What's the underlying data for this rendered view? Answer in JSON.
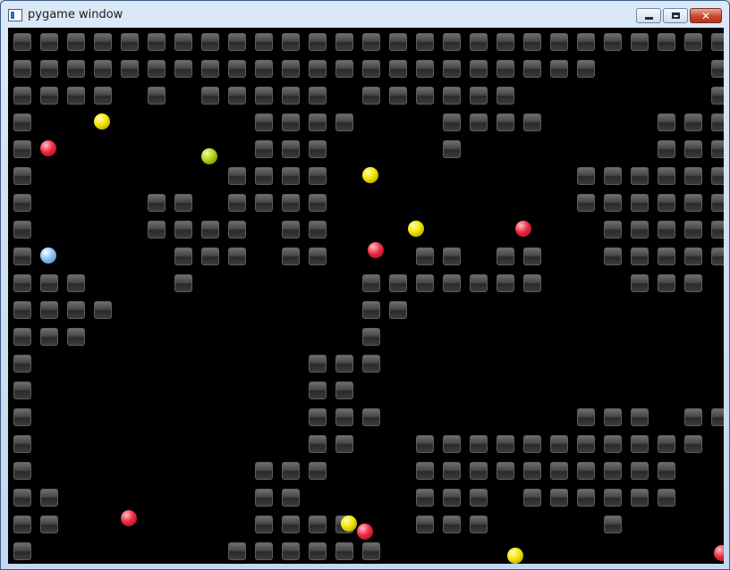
{
  "window": {
    "title": "pygame window",
    "close_glyph": "✕"
  },
  "game": {
    "colors": {
      "background": "#000000",
      "brick": "#4a4a4a"
    },
    "grid": {
      "cols": 27,
      "rows": 20
    },
    "brick_rows": [
      "111111111111111111111111111",
      "111111111111111111111100001",
      "111101011111011111100000001",
      "100000000111100011110000111",
      "100000000111000010000000111",
      "100000001111000000000111111",
      "100001101111000000000111111",
      "100001111011000000000011111",
      "100000111011000110110011111",
      "111000100000011111110001110",
      "111100000000011000000000000",
      "111000000000010000000000000",
      "100000000001110000000000000",
      "100000000001100000000000000",
      "100000000001110000000111011",
      "100000000001100111111111110",
      "100000000111000111111111100",
      "110000000110000111011111100",
      "110000000111100111000010000",
      "100000001111110000000000000"
    ],
    "balls": [
      {
        "col": 3.5,
        "row": 3.5,
        "color": "yellow"
      },
      {
        "col": 1.5,
        "row": 4.5,
        "color": "red"
      },
      {
        "col": 7.5,
        "row": 4.8,
        "color": "green"
      },
      {
        "col": 13.5,
        "row": 5.5,
        "color": "yellow"
      },
      {
        "col": 15.2,
        "row": 7.5,
        "color": "yellow"
      },
      {
        "col": 19.2,
        "row": 7.5,
        "color": "red"
      },
      {
        "col": 13.7,
        "row": 8.3,
        "color": "red"
      },
      {
        "col": 1.5,
        "row": 8.5,
        "color": "blue"
      },
      {
        "col": 4.5,
        "row": 18.3,
        "color": "red"
      },
      {
        "col": 12.7,
        "row": 18.5,
        "color": "yellow"
      },
      {
        "col": 13.3,
        "row": 18.8,
        "color": "red"
      },
      {
        "col": 18.9,
        "row": 19.7,
        "color": "yellow"
      },
      {
        "col": 26.6,
        "row": 19.6,
        "color": "red"
      }
    ]
  }
}
